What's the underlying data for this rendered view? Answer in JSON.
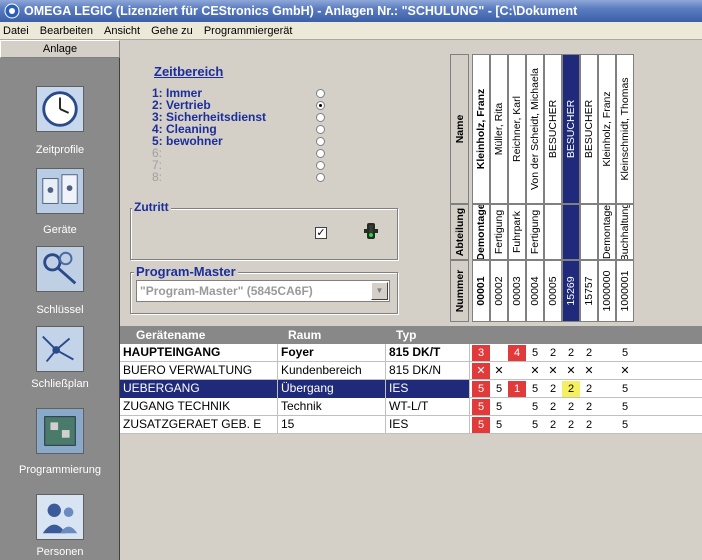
{
  "window": {
    "title": "OMEGA LEGIC (Lizenziert für CEStronics GmbH) - Anlagen Nr.: \"SCHULUNG\" - [C:\\Dokument"
  },
  "menu": [
    "Datei",
    "Bearbeiten",
    "Ansicht",
    "Gehe zu",
    "Programmiergerät"
  ],
  "sidebar": {
    "tab_label": "Anlage",
    "items": [
      {
        "label": "Zeitprofile",
        "icon": "clock-icon"
      },
      {
        "label": "Geräte",
        "icon": "devices-icon"
      },
      {
        "label": "Schlüssel",
        "icon": "keys-icon"
      },
      {
        "label": "Schließplan",
        "icon": "locking-plan-icon"
      },
      {
        "label": "Programmierung",
        "icon": "circuit-board-icon"
      },
      {
        "label": "Personen",
        "icon": "people-icon"
      }
    ]
  },
  "zeitbereich": {
    "title": "Zeitbereich",
    "items": [
      {
        "label": "1: Immer",
        "selected": false,
        "enabled": true
      },
      {
        "label": "2: Vertrieb",
        "selected": true,
        "enabled": true
      },
      {
        "label": "3: Sicherheitsdienst",
        "selected": false,
        "enabled": true
      },
      {
        "label": "4: Cleaning",
        "selected": false,
        "enabled": true
      },
      {
        "label": "5: bewohner",
        "selected": false,
        "enabled": true
      },
      {
        "label": "6:",
        "selected": false,
        "enabled": false
      },
      {
        "label": "7:",
        "selected": false,
        "enabled": false
      },
      {
        "label": "8:",
        "selected": false,
        "enabled": false
      }
    ]
  },
  "zutritt": {
    "title": "Zutritt",
    "checked": true,
    "check_mark": "✓"
  },
  "program_master": {
    "title": "Program-Master",
    "value": "\"Program-Master\" (5845CA6F)",
    "dropdown_glyph": "▼"
  },
  "header_labels": {
    "name": "Name",
    "abteilung": "Abteilung",
    "nummer": "Nummer"
  },
  "persons": [
    {
      "name": "Kleinholz, Franz",
      "abteilung": "Demontage",
      "nummer": "00001",
      "bold": true,
      "selected": false
    },
    {
      "name": "Müller, Rita",
      "abteilung": "Fertigung",
      "nummer": "00002",
      "bold": false,
      "selected": false
    },
    {
      "name": "Reichner, Karl",
      "abteilung": "Fuhrpark",
      "nummer": "00003",
      "bold": false,
      "selected": false
    },
    {
      "name": "Von der Scheidt, Michaela",
      "abteilung": "Fertigung",
      "nummer": "00004",
      "bold": false,
      "selected": false
    },
    {
      "name": "BESUCHER",
      "abteilung": "",
      "nummer": "00005",
      "bold": false,
      "selected": false
    },
    {
      "name": "BESUCHER",
      "abteilung": "",
      "nummer": "15269",
      "bold": false,
      "selected": true
    },
    {
      "name": "BESUCHER",
      "abteilung": "",
      "nummer": "15757",
      "bold": false,
      "selected": false
    },
    {
      "name": "Kleinholz, Franz",
      "abteilung": "Demontage",
      "nummer": "1000000",
      "bold": false,
      "selected": false
    },
    {
      "name": "Kleinschmidt, Thomas",
      "abteilung": "Buchhaltung",
      "nummer": "1000001",
      "bold": false,
      "selected": false
    }
  ],
  "table": {
    "headers": {
      "name": "Gerätename",
      "raum": "Raum",
      "typ": "Typ"
    },
    "rows": [
      {
        "name": "HAUPTEINGANG",
        "raum": "Foyer",
        "typ": "815 DK/T",
        "bold": true,
        "selected": false,
        "cells": [
          {
            "v": "3",
            "c": "red"
          },
          {
            "v": "",
            "c": ""
          },
          {
            "v": "4",
            "c": "red"
          },
          {
            "v": "5",
            "c": ""
          },
          {
            "v": "2",
            "c": ""
          },
          {
            "v": "2",
            "c": ""
          },
          {
            "v": "2",
            "c": ""
          },
          {
            "v": "",
            "c": ""
          },
          {
            "v": "5",
            "c": ""
          }
        ]
      },
      {
        "name": "BUERO VERWALTUNG",
        "raum": "Kundenbereich",
        "typ": "815 DK/N",
        "bold": false,
        "selected": false,
        "cells": [
          {
            "v": "✕",
            "c": "red"
          },
          {
            "v": "✕",
            "c": ""
          },
          {
            "v": "",
            "c": ""
          },
          {
            "v": "✕",
            "c": ""
          },
          {
            "v": "✕",
            "c": ""
          },
          {
            "v": "✕",
            "c": ""
          },
          {
            "v": "✕",
            "c": ""
          },
          {
            "v": "",
            "c": ""
          },
          {
            "v": "✕",
            "c": ""
          }
        ]
      },
      {
        "name": "UEBERGANG",
        "raum": "Übergang",
        "typ": "IES",
        "bold": false,
        "selected": true,
        "cells": [
          {
            "v": "5",
            "c": "red"
          },
          {
            "v": "5",
            "c": ""
          },
          {
            "v": "1",
            "c": "red"
          },
          {
            "v": "5",
            "c": ""
          },
          {
            "v": "2",
            "c": ""
          },
          {
            "v": "2",
            "c": "yellow"
          },
          {
            "v": "2",
            "c": ""
          },
          {
            "v": "",
            "c": ""
          },
          {
            "v": "5",
            "c": ""
          }
        ]
      },
      {
        "name": "ZUGANG TECHNIK",
        "raum": "Technik",
        "typ": "WT-L/T",
        "bold": false,
        "selected": false,
        "cells": [
          {
            "v": "5",
            "c": "red"
          },
          {
            "v": "5",
            "c": ""
          },
          {
            "v": "",
            "c": ""
          },
          {
            "v": "5",
            "c": ""
          },
          {
            "v": "2",
            "c": ""
          },
          {
            "v": "2",
            "c": ""
          },
          {
            "v": "2",
            "c": ""
          },
          {
            "v": "",
            "c": ""
          },
          {
            "v": "5",
            "c": ""
          }
        ]
      },
      {
        "name": "ZUSATZGERAET GEB. E",
        "raum": "15",
        "typ": "IES",
        "bold": false,
        "selected": false,
        "cells": [
          {
            "v": "5",
            "c": "red"
          },
          {
            "v": "5",
            "c": ""
          },
          {
            "v": "",
            "c": ""
          },
          {
            "v": "5",
            "c": ""
          },
          {
            "v": "2",
            "c": ""
          },
          {
            "v": "2",
            "c": ""
          },
          {
            "v": "2",
            "c": ""
          },
          {
            "v": "",
            "c": ""
          },
          {
            "v": "5",
            "c": ""
          }
        ]
      }
    ]
  }
}
